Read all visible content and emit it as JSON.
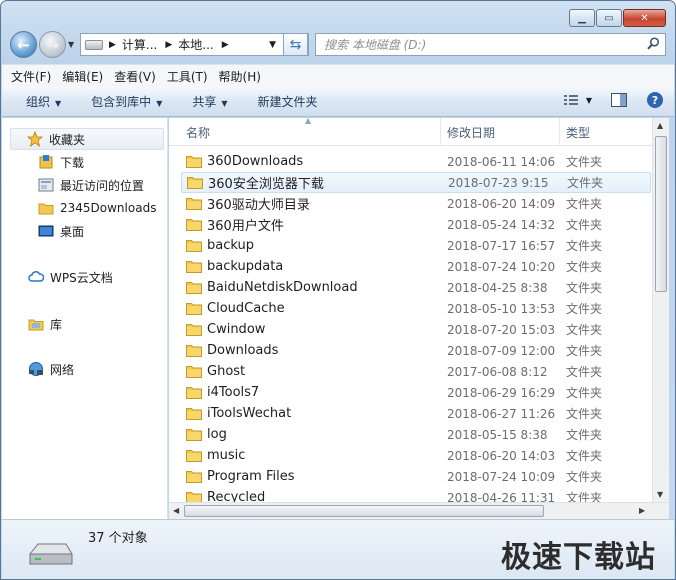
{
  "window": {
    "min_icon": "minimize-icon",
    "max_icon": "maximize-icon",
    "close_icon": "close-icon"
  },
  "address": {
    "segments": [
      "计算...",
      "本地..."
    ]
  },
  "search": {
    "placeholder": "搜索 本地磁盘 (D:)"
  },
  "menu": [
    "文件(F)",
    "编辑(E)",
    "查看(V)",
    "工具(T)",
    "帮助(H)"
  ],
  "toolbar": {
    "organize": "组织",
    "include": "包含到库中",
    "share": "共享",
    "new_folder": "新建文件夹"
  },
  "nav": {
    "favorites": "收藏夹",
    "fav_items": [
      "下载",
      "最近访问的位置",
      "2345Downloads",
      "桌面"
    ],
    "wps": "WPS云文档",
    "library": "库",
    "network": "网络"
  },
  "columns": {
    "name": "名称",
    "date": "修改日期",
    "type": "类型"
  },
  "files": [
    {
      "name": "360Downloads",
      "date": "2018-06-11 14:06",
      "type": "文件夹"
    },
    {
      "name": "360安全浏览器下载",
      "date": "2018-07-23 9:15",
      "type": "文件夹"
    },
    {
      "name": "360驱动大师目录",
      "date": "2018-06-20 14:09",
      "type": "文件夹"
    },
    {
      "name": "360用户文件",
      "date": "2018-05-24 14:32",
      "type": "文件夹"
    },
    {
      "name": "backup",
      "date": "2018-07-17 16:57",
      "type": "文件夹"
    },
    {
      "name": "backupdata",
      "date": "2018-07-24 10:20",
      "type": "文件夹"
    },
    {
      "name": "BaiduNetdiskDownload",
      "date": "2018-04-25 8:38",
      "type": "文件夹"
    },
    {
      "name": "CloudCache",
      "date": "2018-05-10 13:53",
      "type": "文件夹"
    },
    {
      "name": "Cwindow",
      "date": "2018-07-20 15:03",
      "type": "文件夹"
    },
    {
      "name": "Downloads",
      "date": "2018-07-09 12:00",
      "type": "文件夹"
    },
    {
      "name": "Ghost",
      "date": "2017-06-08 8:12",
      "type": "文件夹"
    },
    {
      "name": "i4Tools7",
      "date": "2018-06-29 16:29",
      "type": "文件夹"
    },
    {
      "name": "iToolsWechat",
      "date": "2018-06-27 11:26",
      "type": "文件夹"
    },
    {
      "name": "log",
      "date": "2018-05-15 8:38",
      "type": "文件夹"
    },
    {
      "name": "music",
      "date": "2018-06-20 14:03",
      "type": "文件夹"
    },
    {
      "name": "Program Files",
      "date": "2018-07-24 10:09",
      "type": "文件夹"
    },
    {
      "name": "Recycled",
      "date": "2018-04-26 11:31",
      "type": "文件夹"
    }
  ],
  "status": {
    "count": "37 个对象"
  },
  "watermark": "极速下载站"
}
